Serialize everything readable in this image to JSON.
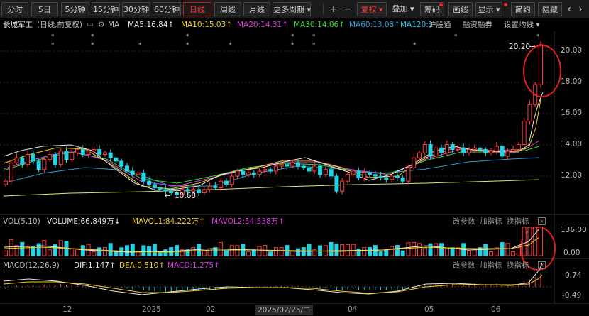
{
  "toolbar": {
    "periods": [
      "分时",
      "5日",
      "5分钟",
      "15分钟",
      "30分钟",
      "60分钟",
      "日线",
      "周线",
      "月线",
      "更多周期"
    ],
    "active_period": "日线",
    "plus": "+",
    "minus": "−",
    "adjust": "复权",
    "overlay": "叠加",
    "chips": "筹码",
    "draw": "画线",
    "display": "显示",
    "simple": "简约",
    "hide": "隐藏",
    "prev": "‹",
    "next": "›"
  },
  "ma_line": {
    "stock": "长城军工",
    "info": "(日线,前复权)",
    "ma_label": "MA",
    "ma5": "MA5:16.84",
    "ma10": "MA10:15.03",
    "ma20": "MA20:14.31",
    "ma30": "MA30:14.06",
    "ma60": "MA60:13.08",
    "ma120": "MA120:1",
    "hgt": "沪股通",
    "margin": "融资融券",
    "settings": "设置均线"
  },
  "price_axis": [
    "20.00",
    "18.00",
    "16.00",
    "14.00",
    "12.00"
  ],
  "annotations": {
    "high": "20.20",
    "low": "10.68"
  },
  "vol_line": {
    "title": "VOL(5,10)",
    "volume": "VOLUME:66.849万",
    "mavol1": "MAVOL1:84.222万",
    "mavol2": "MAVOL2:54.538万",
    "change_params": "改参数",
    "add_indicator": "加指标",
    "switch_indicator": "换指标",
    "close": "×"
  },
  "vol_axis": [
    "136.00",
    "0.00"
  ],
  "macd_line": {
    "title": "MACD(12,26,9)",
    "dif": "DIF:1.147",
    "dea": "DEA:0.510",
    "macd": "MACD:1.275",
    "change_params": "改参数",
    "add_indicator": "加指标",
    "switch_indicator": "换指标",
    "close": "×"
  },
  "macd_axis": [
    "0.74",
    "-0.49"
  ],
  "date_axis": [
    "12",
    "2025",
    "02",
    "04",
    "05",
    "06"
  ],
  "date_cursor": "2025/02/25/二",
  "colors": {
    "up": "#ff3b3b",
    "down": "#22d3e6",
    "ma5": "#e8e8e8",
    "ma10": "#f2d21a",
    "ma20": "#e03be0",
    "ma30": "#33dd33",
    "ma60": "#2e9bd9",
    "highlight_circle": "#e02020"
  },
  "chart_data": {
    "type": "candlestick",
    "ylim": [
      10.0,
      21.0
    ],
    "price_ticks": [
      20,
      18,
      16,
      14,
      12
    ],
    "closes": [
      12.0,
      13.1,
      13.4,
      13.0,
      13.6,
      13.2,
      12.7,
      13.3,
      13.6,
      13.0,
      13.8,
      13.3,
      13.7,
      13.9,
      13.6,
      13.8,
      13.9,
      13.6,
      13.7,
      13.4,
      13.2,
      12.9,
      12.6,
      12.4,
      12.5,
      12.0,
      11.8,
      11.6,
      11.5,
      11.4,
      11.3,
      11.2,
      11.5,
      11.4,
      11.5,
      11.3,
      11.5,
      11.7,
      11.6,
      12.0,
      11.8,
      12.3,
      12.6,
      12.4,
      12.5,
      12.4,
      12.6,
      12.7,
      12.6,
      12.9,
      13.0,
      12.9,
      13.1,
      12.9,
      12.8,
      12.6,
      12.9,
      12.4,
      12.7,
      12.3,
      11.4,
      12.0,
      12.4,
      12.6,
      12.2,
      12.5,
      12.4,
      12.3,
      12.2,
      12.1,
      12.3,
      12.2,
      12.0,
      12.8,
      13.4,
      13.7,
      14.2,
      13.5,
      14.0,
      13.7,
      14.2,
      13.9,
      14.0,
      13.7,
      13.9,
      14.0,
      13.9,
      13.7,
      13.8,
      14.1,
      13.5,
      13.8,
      13.9,
      14.2,
      15.6,
      16.6,
      17.8,
      20.2
    ],
    "annotations": {
      "high": 20.2,
      "low": 10.68
    },
    "volume_axis": [
      136.0,
      0.0
    ],
    "macd_axis": [
      0.74,
      -0.49
    ],
    "ma": {
      "MA5": 16.84,
      "MA10": 15.03,
      "MA20": 14.31,
      "MA30": 14.06,
      "MA60": 13.08
    },
    "volume": {
      "VOLUME": "66.849万",
      "MAVOL1": "84.222万",
      "MAVOL2": "54.538万"
    },
    "macd": {
      "DIF": 1.147,
      "DEA": 0.51,
      "MACD": 1.275
    }
  }
}
